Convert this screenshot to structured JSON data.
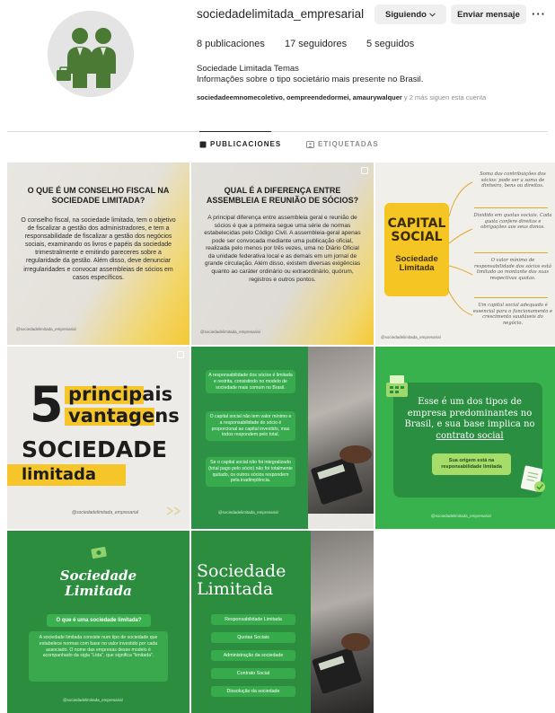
{
  "profile": {
    "username": "sociedadelimitada_empresarial",
    "follow_button": "Siguiendo",
    "message_button": "Enviar mensaje",
    "more_icon": "more-icon",
    "stats": {
      "posts": "8 publicaciones",
      "followers": "17 seguidores",
      "following": "5 seguidos"
    },
    "bio_name": "Sociedade Limitada Temas",
    "bio_text": "Informações sobre o tipo societário mais presente no Brasil.",
    "followed_by_names": "sociedadeemnomecoletivo, oempreendedormei, amaurywalquer",
    "followed_by_rest": " y 2 más siguen esta cuenta"
  },
  "tabs": {
    "posts": "PUBLICACIONES",
    "tagged": "ETIQUETADAS"
  },
  "posts": {
    "p1": {
      "title": "O que é um conselho fiscal na Sociedade Limitada?",
      "body": "O conselho fiscal, na sociedade limitada, tem o objetivo de fiscalizar a gestão dos administradores, e tem a responsabilidade de fiscalizar a gestão dos negócios sociais, examinando os livros e papéis da sociedade trimestralmente e emitindo pareceres sobre a regularidade da gestão. Além disso, deve denunciar irregularidades e convocar assembleias de sócios em casos específicos.",
      "handle": "@sociedadelimitada_empresarial"
    },
    "p2": {
      "title": "Qual é a diferença entre assembleia e reunião de sócios?",
      "body": "A principal diferença entre assembleia geral e reunião de sócios é que a primeira segue uma série de normas estabelecidas pelo Código Civil. A assembleia-geral apenas pode ser convocada mediante uma publicação oficial, realizada pelo menos por três vezes, uma no Diário Oficial da unidade federativa local e as demais em um jornal de grande circulação. Além disso, existem diversas exigências quanto ao caráter ordinário ou extraordinário, quórum, registros e outros pontos.",
      "handle": "@sociedadelimitada_empresarial"
    },
    "p3": {
      "title": "CAPITAL SOCIAL",
      "subtitle": "Sociedade Limitada",
      "notes": [
        "Soma das contribuições dos sócios: pode ser a soma de dinheiro, bens ou direitos.",
        "Dividido em quotas sociais. Cada quota confere direitos e obrigações aos seus donos.",
        "O valor mínimo de responsabilidade dos sócios está limitado ao montante das suas respectivas quotas.",
        "Um capital social adequado é essencial para o funcionamento e crescimento saudáveis do negócio."
      ],
      "handle": "@sociedadelimitada_empresarial"
    },
    "p4": {
      "number": "5",
      "line1": "principais",
      "line2": "vantagens",
      "line3": "SOCIEDADE",
      "line4": "limitada",
      "handle": "@sociedadelimitada_empresarial"
    },
    "p5": {
      "boxes": [
        "A responsabilidade dos sócios é limitada e restrita, consistindo no modelo de sociedade mais comum no Brasil.",
        "O capital social não tem valor mínimo e a responsabilidade do sócio é proporcional ao capital investido, mas todos respondem pelo total.",
        "Se o capital social não foi integralizado (total pago pelo sócio) não foi totalmente quitado, os outros sócios respondem pela inadimplência."
      ],
      "handle": "@sociedadelimitada_empresarial"
    },
    "p6": {
      "text_before": "Esse é um dos tipos de empresa predominantes no Brasil, e sua base implica no ",
      "text_link": "contrato social",
      "button": "Sua origem está na responsabilidade limitada",
      "handle": "@sociedadelimitada_empresarial"
    },
    "p7": {
      "title_line1": "Sociedade",
      "title_line2": "Limitada",
      "question": "O que é uma sociedade limitada?",
      "body": "A sociedade limitada consiste num tipo de sociedade que estabelece normas com base no valor investido por cada associado. O nome das empresas desse modelo é acompanhado da sigla \"Ltda\", que significa \"limitada\".",
      "handle": "@sociedadelimitada_empresarial"
    },
    "p8": {
      "title_line1": "Sociedade",
      "title_line2": "Limitada",
      "items": [
        "Responsabilidade Limitada",
        "Quotas Sociais",
        "Administração da sociedade",
        "Contrato Social",
        "Dissolução da sociedade"
      ]
    }
  },
  "colors": {
    "accent_yellow": "#f5c623",
    "accent_green": "#2c8d3f",
    "light_green": "#a6dd68"
  }
}
